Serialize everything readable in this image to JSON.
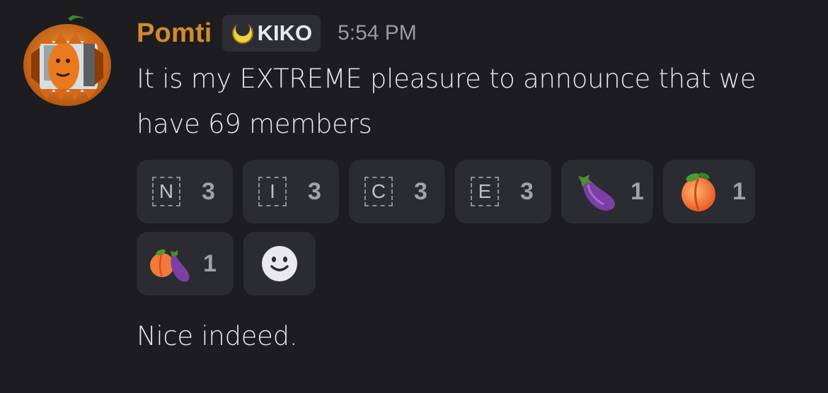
{
  "message": {
    "author": "Pomti",
    "tag": "KIKO",
    "timestamp": "5:54 PM",
    "text": "It is my EXTREME pleasure to announce that we have 69 members",
    "followup_text": "Nice indeed."
  },
  "reactions": [
    {
      "emoji": "N",
      "kind": "letter",
      "count": "3"
    },
    {
      "emoji": "I",
      "kind": "letter",
      "count": "3"
    },
    {
      "emoji": "C",
      "kind": "letter",
      "count": "3"
    },
    {
      "emoji": "E",
      "kind": "letter",
      "count": "3"
    },
    {
      "emoji": "eggplant",
      "kind": "emoji",
      "count": "1"
    },
    {
      "emoji": "peach",
      "kind": "emoji",
      "count": "1"
    },
    {
      "emoji": "peach-eggplant",
      "kind": "custom-emoji",
      "count": "1"
    }
  ],
  "icons": {
    "avatar": "pumpkin-avatar-icon",
    "tag_icon": "yellow-moon-tag-icon",
    "add_reaction": "smiley-add-reaction-icon"
  },
  "colors": {
    "background": "#1c1c21",
    "username": "#d38b2a",
    "reaction_bg": "#2b2b32",
    "tag_bg": "#2d2d34",
    "timestamp": "#9a9aa3"
  }
}
